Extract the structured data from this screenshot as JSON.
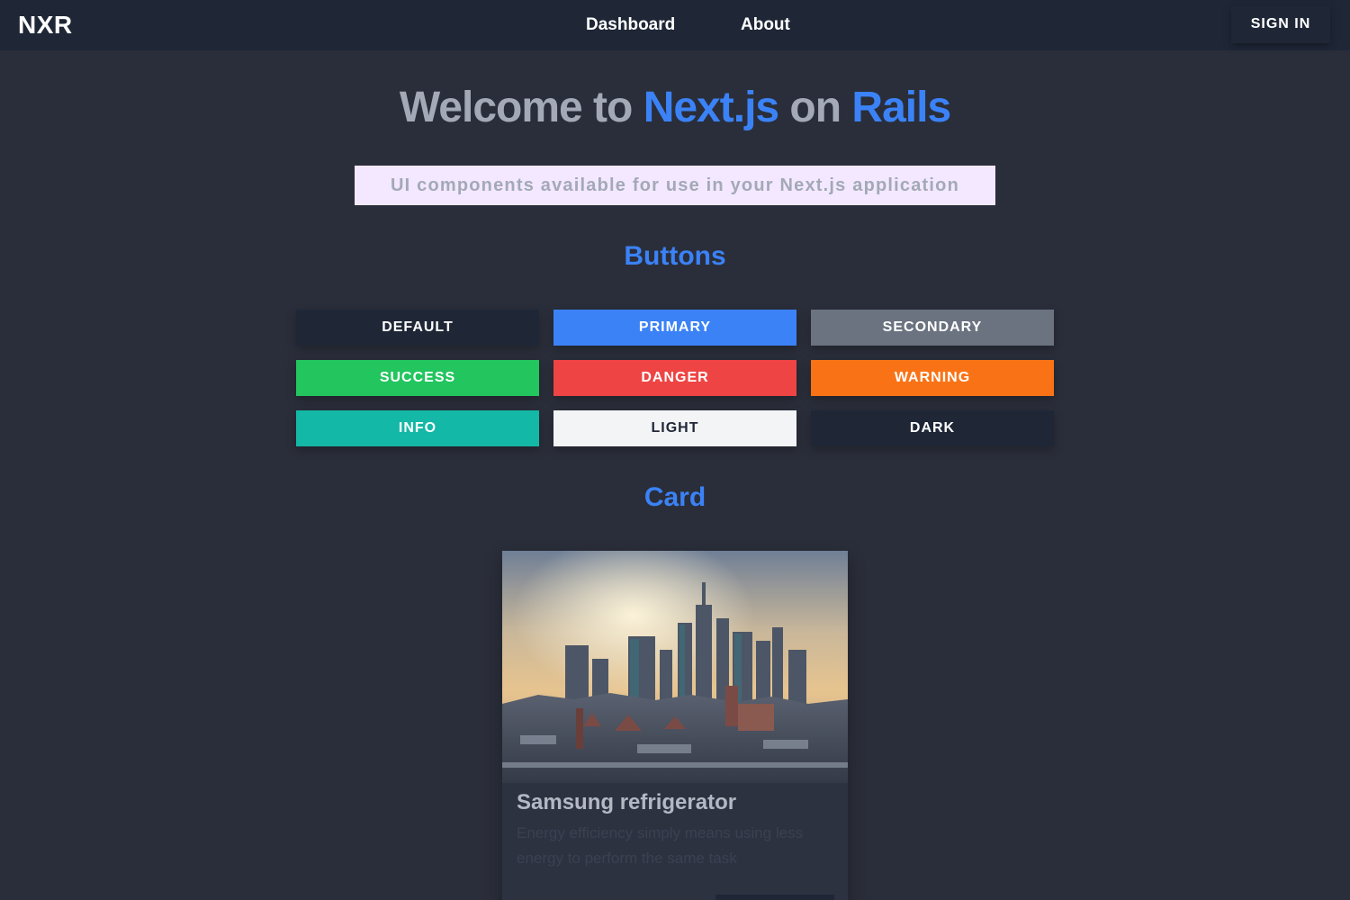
{
  "navbar": {
    "logo": "NXR",
    "links": [
      "Dashboard",
      "About"
    ],
    "signin_label": "SIGN IN"
  },
  "hero": {
    "title_parts": [
      "Welcome to ",
      "Next.js",
      " on ",
      "Rails"
    ],
    "subtitle": "UI components available for use in your Next.js application"
  },
  "sections": {
    "buttons_title": "Buttons",
    "card_title": "Card"
  },
  "buttons": [
    {
      "label": "DEFAULT",
      "color": "#1f2737",
      "text_color": "#ffffff"
    },
    {
      "label": "PRIMARY",
      "color": "#3b82f6",
      "text_color": "#ffffff"
    },
    {
      "label": "SECONDARY",
      "color": "#6b7280",
      "text_color": "#ffffff"
    },
    {
      "label": "SUCCESS",
      "color": "#22c55e",
      "text_color": "#ffffff"
    },
    {
      "label": "DANGER",
      "color": "#ef4444",
      "text_color": "#ffffff"
    },
    {
      "label": "WARNING",
      "color": "#f97316",
      "text_color": "#ffffff"
    },
    {
      "label": "INFO",
      "color": "#14b8a6",
      "text_color": "#ffffff"
    },
    {
      "label": "LIGHT",
      "color": "#f3f4f6",
      "text_color": "#1f2737"
    },
    {
      "label": "DARK",
      "color": "#1f2737",
      "text_color": "#ffffff"
    }
  ],
  "card": {
    "title": "Samsung refrigerator",
    "description": "Energy efficiency simply means using less energy to perform the same task"
  },
  "colors": {
    "background": "#2a2e3a",
    "navbar": "#1f2737",
    "accent": "#3b82f6",
    "muted_text": "#a3a9b6",
    "subtitle_bg": "#f3e8ff"
  }
}
